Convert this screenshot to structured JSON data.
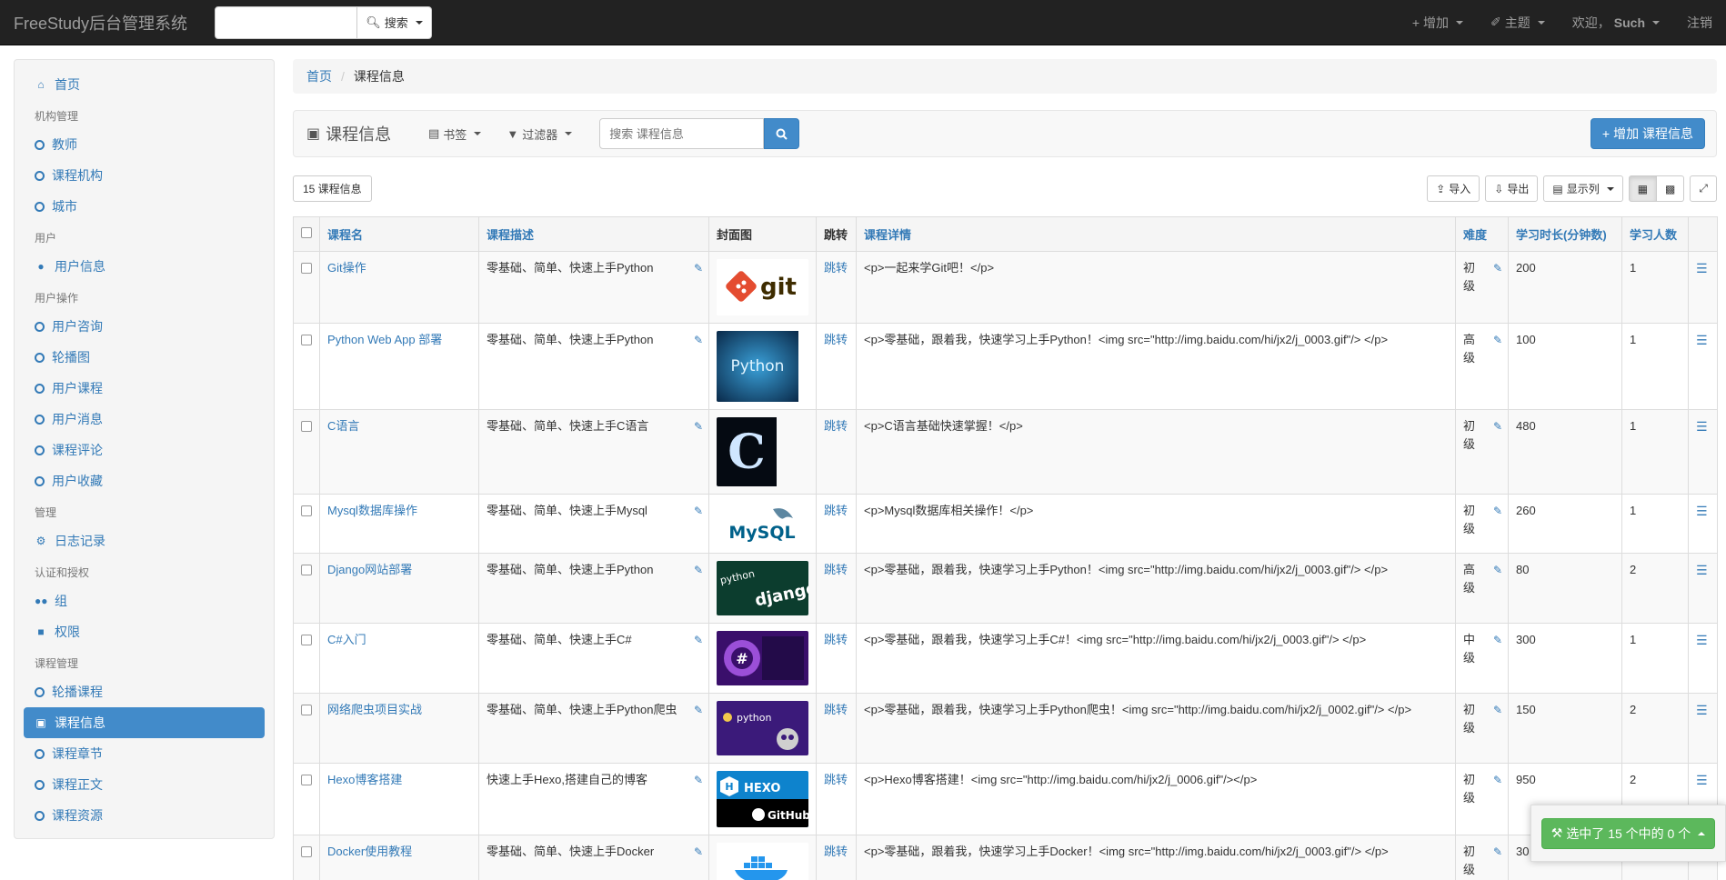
{
  "nav": {
    "brand": "FreeStudy后台管理系统",
    "search_placeholder": "",
    "search_btn": "搜索",
    "add": "增加",
    "theme": "主题",
    "welcome": "欢迎，",
    "user": "Such",
    "logout": "注销"
  },
  "sidebar": {
    "home": "首页",
    "groups": [
      {
        "header": "机构管理",
        "items": [
          "教师",
          "课程机构",
          "城市"
        ]
      },
      {
        "header": "用户",
        "items": [
          "用户信息"
        ]
      },
      {
        "header": "用户操作",
        "items": [
          "用户咨询",
          "轮播图",
          "用户课程",
          "用户消息",
          "课程评论",
          "用户收藏"
        ]
      },
      {
        "header": "管理",
        "items": [
          "日志记录"
        ]
      },
      {
        "header": "认证和授权",
        "items": [
          "组",
          "权限"
        ]
      },
      {
        "header": "课程管理",
        "items": [
          "轮播课程",
          "课程信息",
          "课程章节",
          "课程正文",
          "课程资源"
        ]
      }
    ]
  },
  "breadcrumb": {
    "home": "首页",
    "current": "课程信息"
  },
  "toolbar": {
    "title": "课程信息",
    "bookmarks": "书签",
    "filters": "过滤器",
    "search_placeholder": "搜索 课程信息",
    "add_btn": "增加 课程信息"
  },
  "list": {
    "count": "15 课程信息",
    "import": "导入",
    "export": "导出",
    "columns": "显示列"
  },
  "table": {
    "headers": [
      "课程名",
      "课程描述",
      "封面图",
      "跳转",
      "课程详情",
      "难度",
      "学习时长(分钟数)",
      "学习人数"
    ],
    "rows": [
      {
        "name": "Git操作",
        "desc": "零基础、简单、快速上手Python",
        "cover": "git",
        "jump": "跳转",
        "detail": "<p>一起来学Git吧！</p>",
        "level": "初级",
        "duration": "200",
        "students": "1"
      },
      {
        "name": "Python Web App 部署",
        "desc": "零基础、简单、快速上手Python",
        "cover": "python",
        "jump": "跳转",
        "detail": "<p>零基础，跟着我，快速学习上手Python！<img src=\"http://img.baidu.com/hi/jx2/j_0003.gif\"/> </p>",
        "level": "高级",
        "duration": "100",
        "students": "1"
      },
      {
        "name": "C语言",
        "desc": "零基础、简单、快速上手C语言",
        "cover": "c",
        "jump": "跳转",
        "detail": "<p>C语言基础快速掌握！</p>",
        "level": "初级",
        "duration": "480",
        "students": "1"
      },
      {
        "name": "Mysql数据库操作",
        "desc": "零基础、简单、快速上手Mysql",
        "cover": "mysql",
        "jump": "跳转",
        "detail": "<p>Mysql数据库相关操作！</p>",
        "level": "初级",
        "duration": "260",
        "students": "1"
      },
      {
        "name": "Django网站部署",
        "desc": "零基础、简单、快速上手Python",
        "cover": "django",
        "jump": "跳转",
        "detail": "<p>零基础，跟着我，快速学习上手Python！<img src=\"http://img.baidu.com/hi/jx2/j_0003.gif\"/> </p>",
        "level": "高级",
        "duration": "80",
        "students": "2"
      },
      {
        "name": "C#入门",
        "desc": "零基础、简单、快速上手C#",
        "cover": "csharp",
        "jump": "跳转",
        "detail": "<p>零基础，跟着我，快速学习上手C#！<img src=\"http://img.baidu.com/hi/jx2/j_0003.gif\"/> </p>",
        "level": "中级",
        "duration": "300",
        "students": "1"
      },
      {
        "name": "网络爬虫项目实战",
        "desc": "零基础、简单、快速上手Python爬虫",
        "cover": "spider",
        "jump": "跳转",
        "detail": "<p>零基础，跟着我，快速学习上手Python爬虫！<img src=\"http://img.baidu.com/hi/jx2/j_0002.gif\"/> </p>",
        "level": "初级",
        "duration": "150",
        "students": "2"
      },
      {
        "name": "Hexo博客搭建",
        "desc": "快速上手Hexo,搭建自己的博客",
        "cover": "hexo",
        "jump": "跳转",
        "detail": "<p>Hexo博客搭建！<img src=\"http://img.baidu.com/hi/jx2/j_0006.gif\"/></p>",
        "level": "初级",
        "duration": "950",
        "students": "2"
      },
      {
        "name": "Docker使用教程",
        "desc": "零基础、简单、快速上手Docker",
        "cover": "docker",
        "jump": "跳转",
        "detail": "<p>零基础，跟着我，快速学习上手Docker！<img src=\"http://img.baidu.com/hi/jx2/j_0003.gif\"/> </p>",
        "level": "初级",
        "duration": "30",
        "students": ""
      }
    ]
  },
  "cover_text": {
    "git": "git",
    "python": "Python",
    "c": "C",
    "mysql": "MySQL",
    "django_small": "python",
    "django": "django",
    "spider": "python",
    "hexo": "HEXO",
    "github": "GitHub",
    "docker": "docker"
  },
  "selection": {
    "label": "选中了 15 个中的 0 个"
  },
  "colors": {
    "primary": "#428bca",
    "success": "#5cb85c",
    "navbar": "#222222"
  }
}
